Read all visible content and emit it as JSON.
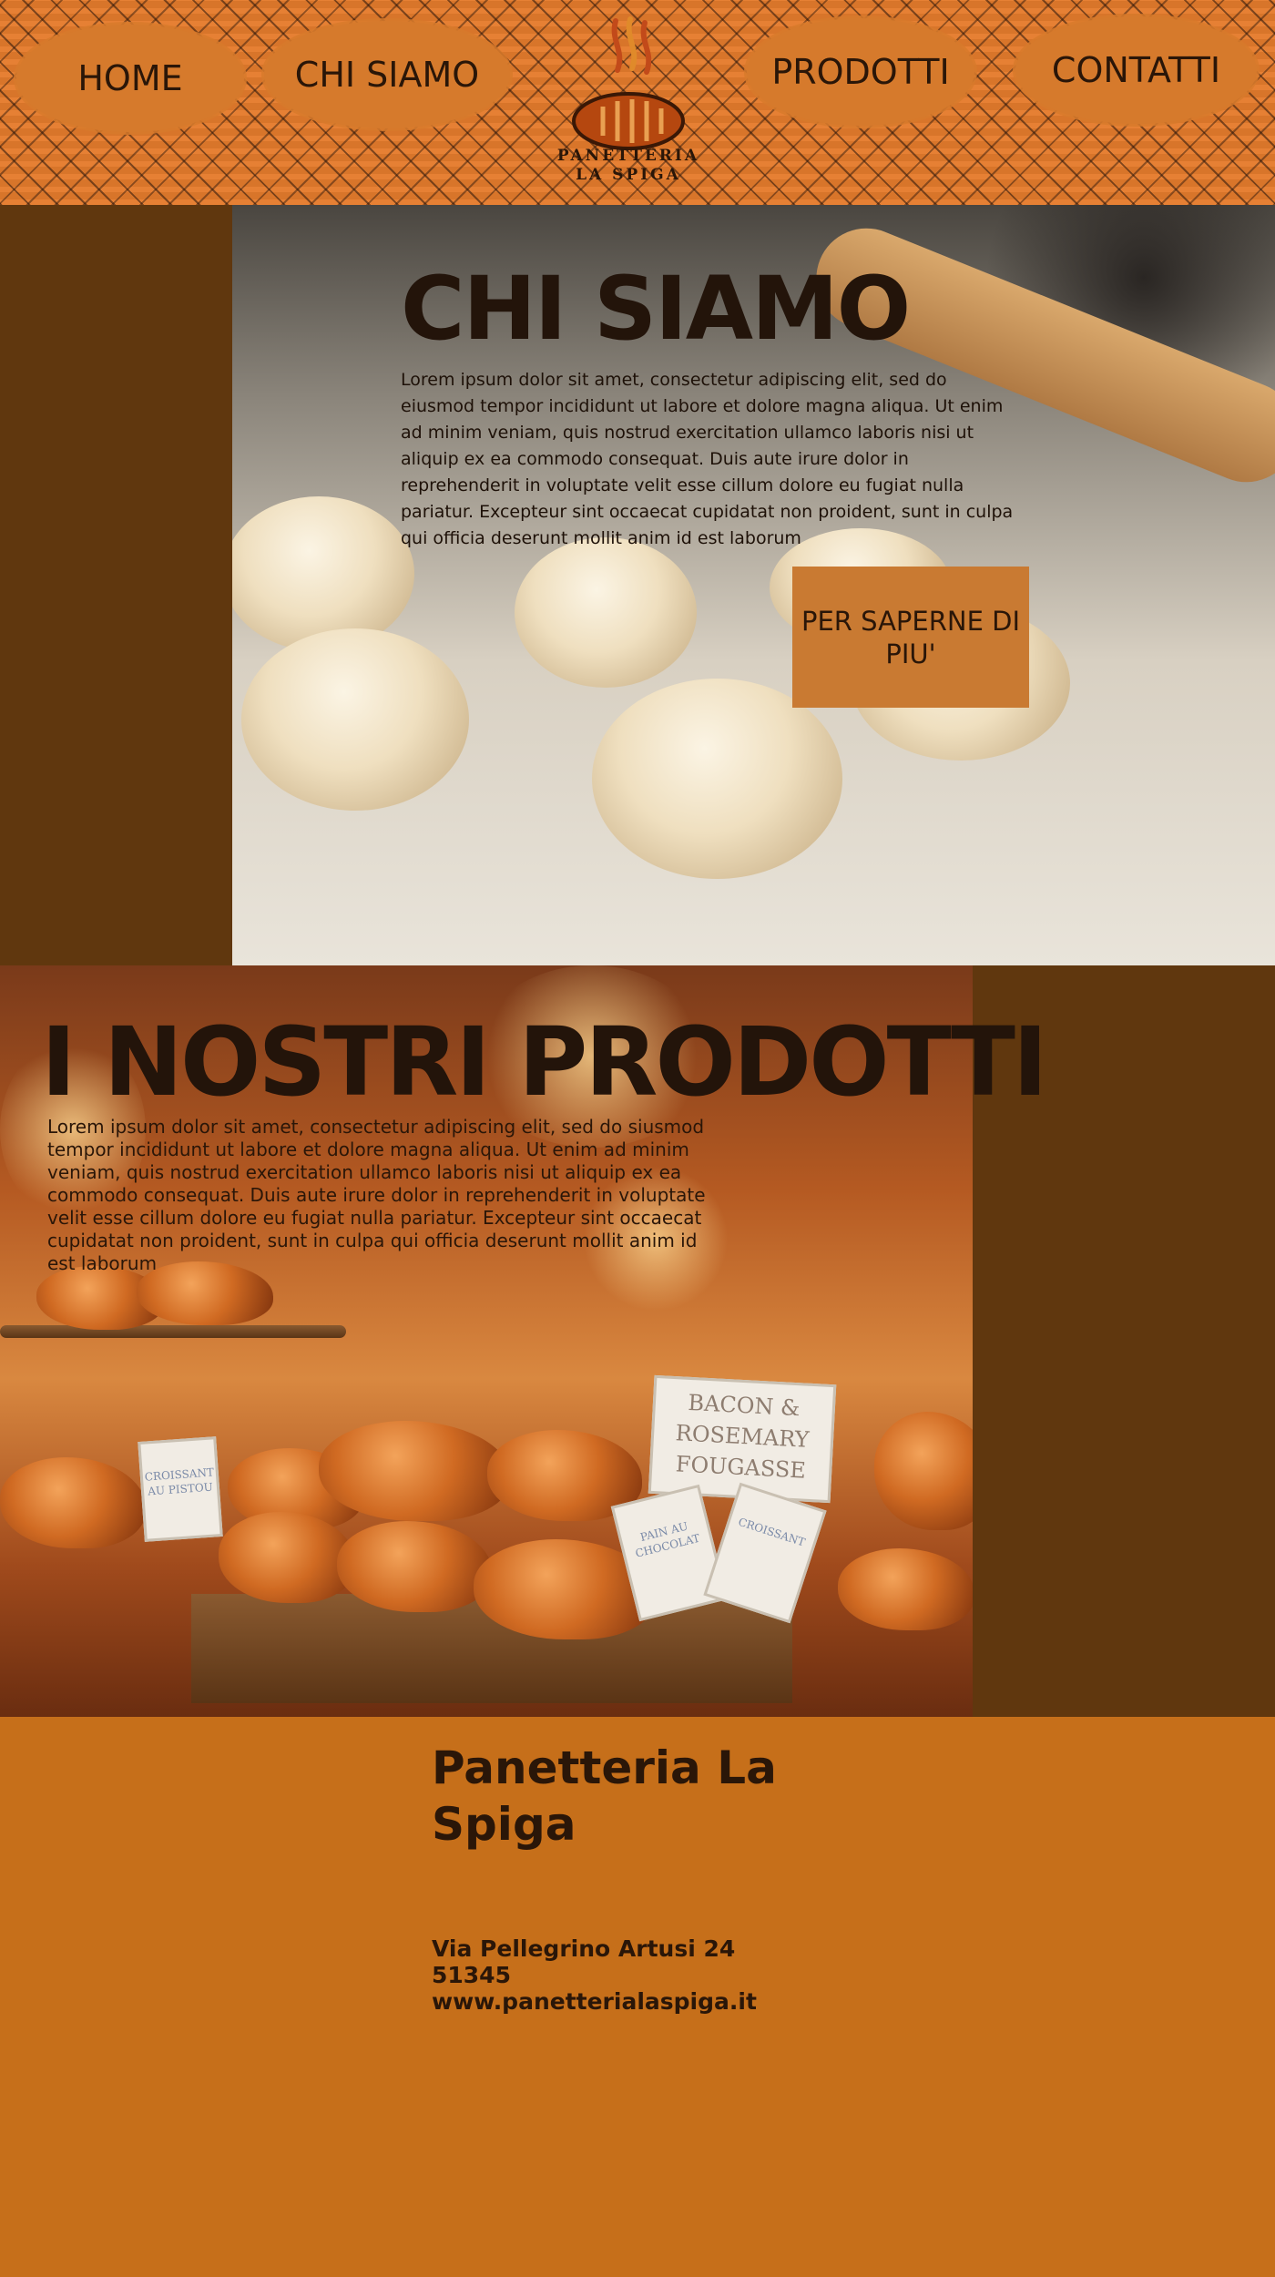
{
  "nav": {
    "home": "HOME",
    "chi_siamo": "CHI SIAMO",
    "prodotti": "PRODOTTI",
    "contatti": "CONTATTI"
  },
  "logo": {
    "line1": "PANETTERIA",
    "line2": "LA SPIGA"
  },
  "chi_siamo": {
    "title": "CHI SIAMO",
    "text": "Lorem ipsum dolor sit amet, consectetur adipiscing elit, sed do eiusmod tempor incididunt ut labore et dolore magna aliqua. Ut enim ad minim veniam, quis nostrud exercitation ullamco laboris nisi ut aliquip ex ea commodo consequat. Duis aute irure dolor in reprehenderit in voluptate velit esse cillum dolore eu fugiat nulla pariatur. Excepteur sint occaecat cupidatat non proident, sunt in culpa qui officia deserunt mollit anim id est laborum",
    "cta": "PER SAPERNE DI PIU'"
  },
  "prodotti": {
    "title": "I NOSTRI PRODOTTI",
    "text": "Lorem ipsum dolor sit amet, consectetur adipiscing elit, sed do siusmod tempor incididunt ut labore et dolore magna aliqua. Ut enim ad minim veniam, quis nostrud exercitation ullamco laboris nisi ut aliquip ex ea commodo consequat. Duis aute irure dolor in reprehenderit in voluptate velit esse cillum dolore eu fugiat nulla pariatur. Excepteur sint occaecat cupidatat non proident, sunt in culpa qui officia deserunt mollit anim id est laborum",
    "sign_main": "BACON & ROSEMARY FOUGASSE",
    "sign_croissant_pistou": "CROISSANT AU PISTOU",
    "sign_pain_chocolat": "PAIN AU CHOCOLAT",
    "sign_croissant": "CROISSANT"
  },
  "footer": {
    "name": "Panetteria La Spiga",
    "address": "Via Pellegrino Artusi 24",
    "cap": "51345",
    "website": "www.panetterialaspiga.it"
  },
  "colors": {
    "header_orange": "#d8752a",
    "dark_brown": "#60370e",
    "footer_orange": "#c66f1a",
    "cta_orange": "#c97a32",
    "text_dark": "#23140a"
  }
}
